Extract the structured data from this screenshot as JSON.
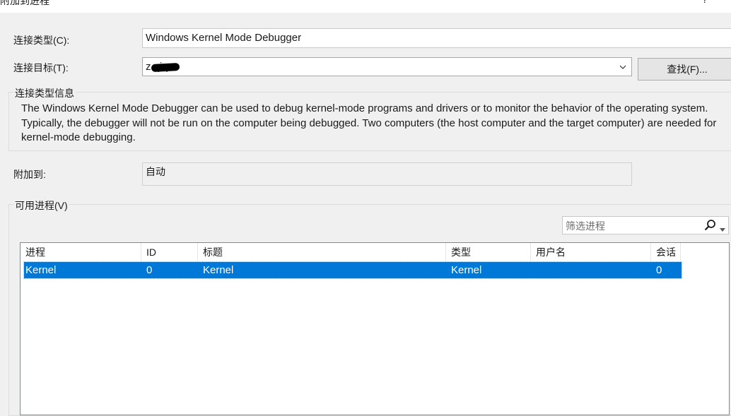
{
  "window": {
    "title": "附加到进程",
    "help": "?"
  },
  "connection_type": {
    "label": "连接类型(C):",
    "value": "Windows Kernel Mode Debugger"
  },
  "connection_target": {
    "label": "连接目标(T):",
    "value": "z qi-pc",
    "find_button": "查找(F)..."
  },
  "info": {
    "title": "连接类型信息",
    "text": "The Windows Kernel Mode Debugger can be used to debug kernel-mode programs and drivers or to monitor the behavior of the operating system. Typically, the debugger will not be run on the computer being debugged. Two computers (the host computer and the target computer) are needed for kernel-mode debugging."
  },
  "attach_to": {
    "label": "附加到:",
    "value": "自动"
  },
  "processes": {
    "title": "可用进程(V)",
    "filter_placeholder": "筛选进程",
    "columns": [
      "进程",
      "ID",
      "标题",
      "类型",
      "用户名",
      "会话"
    ],
    "rows": [
      {
        "process": "Kernel",
        "id": "0",
        "title": "Kernel",
        "type": "Kernel",
        "user": "",
        "session": "0"
      }
    ]
  },
  "icons": {
    "dropdown": "chevron-down-icon",
    "search": "search-icon",
    "filter_dropdown": "caret-down-icon"
  },
  "colors": {
    "selection": "#0078d7",
    "background": "#f0f0f0"
  }
}
